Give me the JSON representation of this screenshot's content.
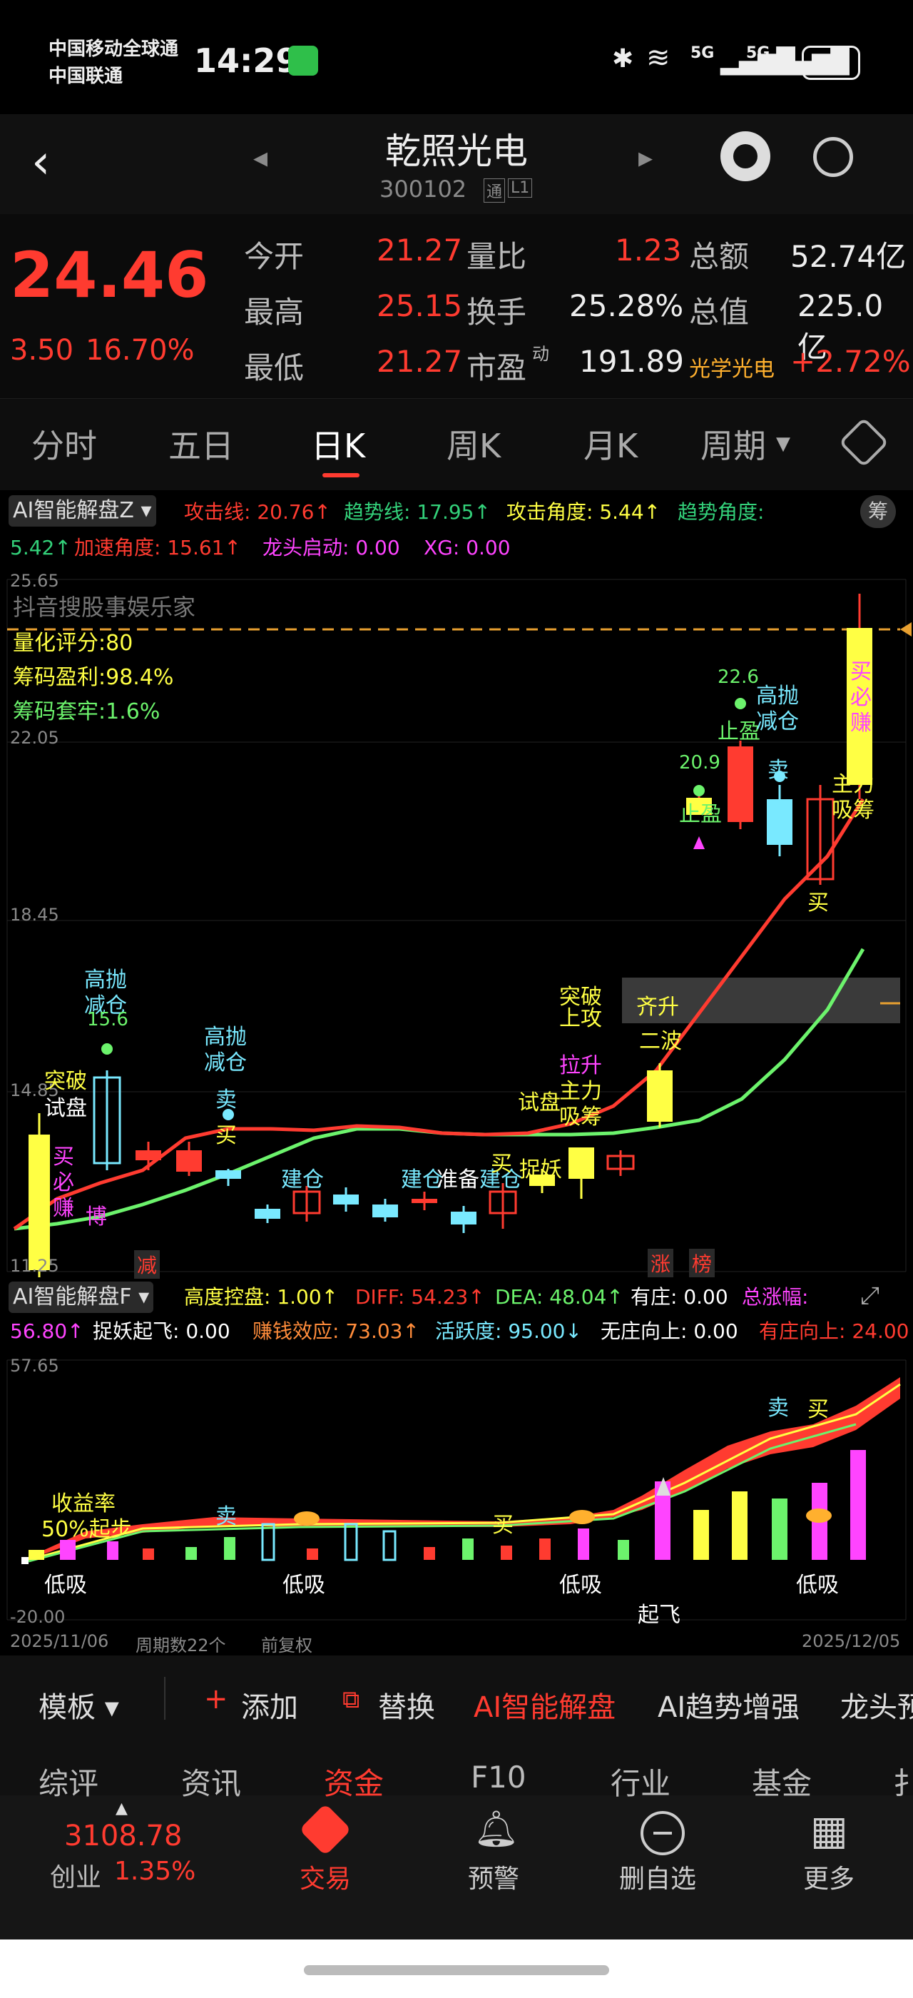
{
  "status": {
    "carrier1": "中国移动全球通",
    "carrier2": "中国联通",
    "time": "14:29",
    "battery": "69",
    "signal1": "5G",
    "signal2": "5G"
  },
  "nav": {
    "title": "乾照光电",
    "code": "300102",
    "badge1": "通",
    "badge2": "L1"
  },
  "quote": {
    "price": "24.46",
    "change": "3.50",
    "change_pct": "16.70%",
    "open_label": "今开",
    "open": "21.27",
    "vr_label": "量比",
    "vr": "1.23",
    "amt_label": "总额",
    "amt": "52.74亿",
    "high_label": "最高",
    "high": "25.15",
    "tr_label": "换手",
    "tr": "25.28%",
    "mv_label": "总值",
    "mv": "225.0亿",
    "low_label": "最低",
    "low": "21.27",
    "pe_label": "市盈",
    "pe_sup": "动",
    "pe": "191.89",
    "sector": "光学光电",
    "sector_pct": "+2.72%"
  },
  "tabs": [
    "分时",
    "五日",
    "日K",
    "周K",
    "月K",
    "周期"
  ],
  "ind1": {
    "name": "AI智能解盘Z",
    "l1": "攻击线: 20.76↑",
    "l2": "趋势线: 17.95↑",
    "l3": "攻击角度: 5.44↑",
    "l4": "趋势角度:",
    "l5": "5.42↑",
    "l6": "加速角度: 15.61↑",
    "l7": "龙头启动: 0.00",
    "l8": "XG: 0.00",
    "badge": "筹"
  },
  "chart": {
    "watermark": "抖音搜股事娱乐家",
    "score": "量化评分:80",
    "profit": "筹码盈利:98.4%",
    "trapped": "筹码套牢:1.6%",
    "y_max": "25.65",
    "y2": "22.05",
    "y3": "18.45",
    "y4": "14.85",
    "y_min": "11.25",
    "labels": {
      "a": "高抛",
      "b": "减仓",
      "c": "15.6",
      "d": "突破",
      "e": "试盘",
      "f": "买",
      "g": "必",
      "h": "赚",
      "i": "博",
      "j": "建仓",
      "k": "准备",
      "l": "捉妖",
      "m": "齐升",
      "n": "二波",
      "o": "拉升",
      "p": "主力",
      "q": "吸筹",
      "r": "20.9",
      "s": "止盈",
      "t": "22.6",
      "u": "卖",
      "v": "主力",
      "w": "吸筹",
      "x": "减",
      "y": "涨",
      "z": "榜",
      "sell": "卖",
      "buy": "买",
      "up": "上攻",
      "buildc": "建仓",
      "buy2": "买"
    }
  },
  "ind2": {
    "name": "AI智能解盘F",
    "l1": "高度控盘: 1.00↑",
    "l2": "DIFF: 54.23↑",
    "l3": "DEA: 48.04↑",
    "l4": "有庄: 0.00",
    "l5": "总涨幅:",
    "l6": "56.80↑",
    "l7": "捉妖起飞: 0.00",
    "l8": "赚钱效应: 73.03↑",
    "l9": "活跃度: 95.00↓",
    "l10": "无庄向上: 0.00",
    "l11": "有庄向上: 24.00",
    "ymax": "57.65",
    "ymin": "-20.00",
    "a": "收益率",
    "b": "50%起步",
    "c": "低吸",
    "d": "起飞",
    "e": "卖",
    "f": "买"
  },
  "range": {
    "start": "2025/11/06",
    "count": "周期数22个",
    "adj": "前复权",
    "end": "2025/12/05"
  },
  "toolbar": {
    "template": "模板",
    "add": "添加",
    "replace": "替换",
    "ai": "AI智能解盘",
    "trend": "AI趋势增强",
    "dragon": "龙头预"
  },
  "subtabs": [
    "综评",
    "资讯",
    "资金",
    "F10",
    "行业",
    "基金",
    "扌"
  ],
  "footer": {
    "index": "3108.78",
    "index_name": "创业",
    "index_pct": "1.35%",
    "trade": "交易",
    "alert": "预警",
    "remove": "删自选",
    "more": "更多"
  },
  "colors": {
    "up": "#ff3b30",
    "down": "#79e9ff",
    "yellow": "#ffff44",
    "green": "#6cf36c",
    "magenta": "#ff44ff"
  }
}
